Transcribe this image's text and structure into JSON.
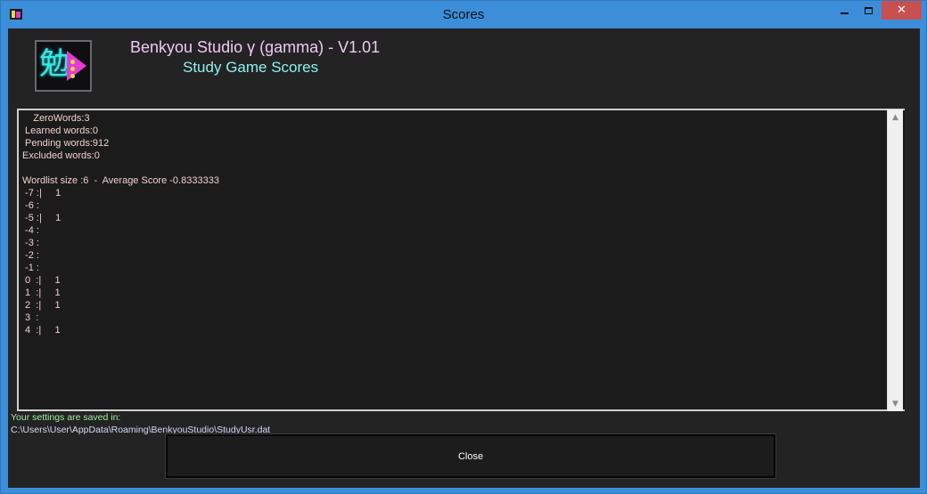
{
  "window": {
    "title": "Scores",
    "minimize_icon": "minimize-icon",
    "maximize_icon": "maximize-icon",
    "close_icon": "close-icon",
    "close_glyph": "✕"
  },
  "header": {
    "app_title": "Benkyou Studio γ (gamma) - V1.01",
    "subtitle": "Study Game Scores",
    "logo_icon": "benkyou-logo-icon",
    "logo_kanji": "勉",
    "title_color": "#f1c8f6",
    "subtitle_color": "#8ff0f0"
  },
  "scores": {
    "lines": [
      "    ZeroWords:3",
      " Learned words:0",
      " Pending words:912",
      "Excluded words:0",
      "",
      "Wordlist size :6  -  Average Score -0.8333333",
      " -7 :|     1",
      " -6 :",
      " -5 :|     1",
      " -4 :",
      " -3 :",
      " -2 :",
      " -1 :",
      " 0  :|     1",
      " 1  :|     1",
      " 2  :|     1",
      " 3  :",
      " 4  :|     1"
    ],
    "text_color": "#f0d0d0"
  },
  "scrollbar": {
    "up_glyph": "▲",
    "down_glyph": "▼"
  },
  "footer": {
    "settings_label": "Your settings are saved in:",
    "settings_path": "C:\\Users\\User\\AppData\\Roaming\\BenkyouStudio\\StudyUsr.dat",
    "close_label": "Close"
  }
}
